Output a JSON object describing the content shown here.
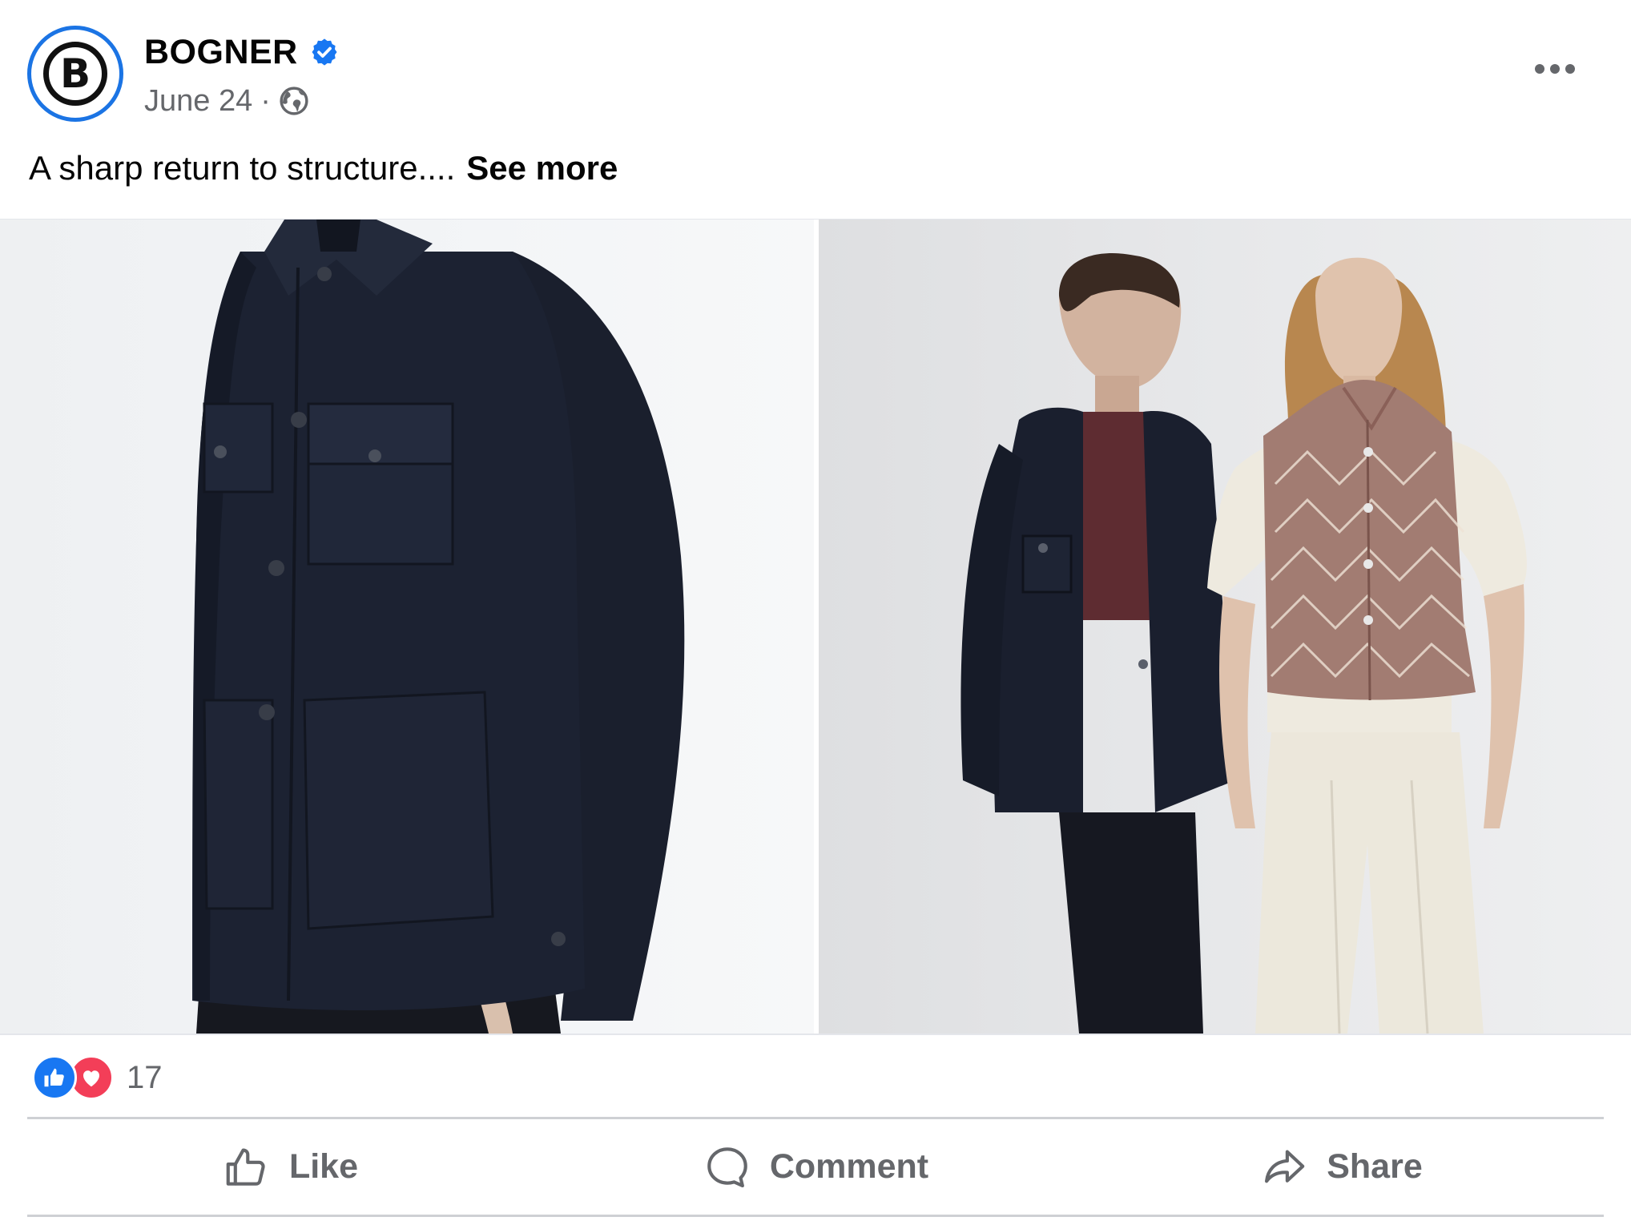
{
  "post": {
    "author": {
      "name": "BOGNER",
      "avatar_letter": "B",
      "verified_icon": "verified-badge-icon"
    },
    "meta": {
      "date": "June 24",
      "separator": "·",
      "privacy_icon": "globe-icon"
    },
    "caption": {
      "text": "A sharp return to structure....",
      "see_more_label": "See more"
    },
    "reactions": {
      "types": [
        "like",
        "love"
      ],
      "count": "17"
    },
    "actions": {
      "like_label": "Like",
      "comment_label": "Comment",
      "share_label": "Share"
    }
  },
  "colors": {
    "accent": "#1b74e4",
    "like": "#1877f2",
    "love": "#f33e58",
    "secondary_text": "#65676b"
  }
}
